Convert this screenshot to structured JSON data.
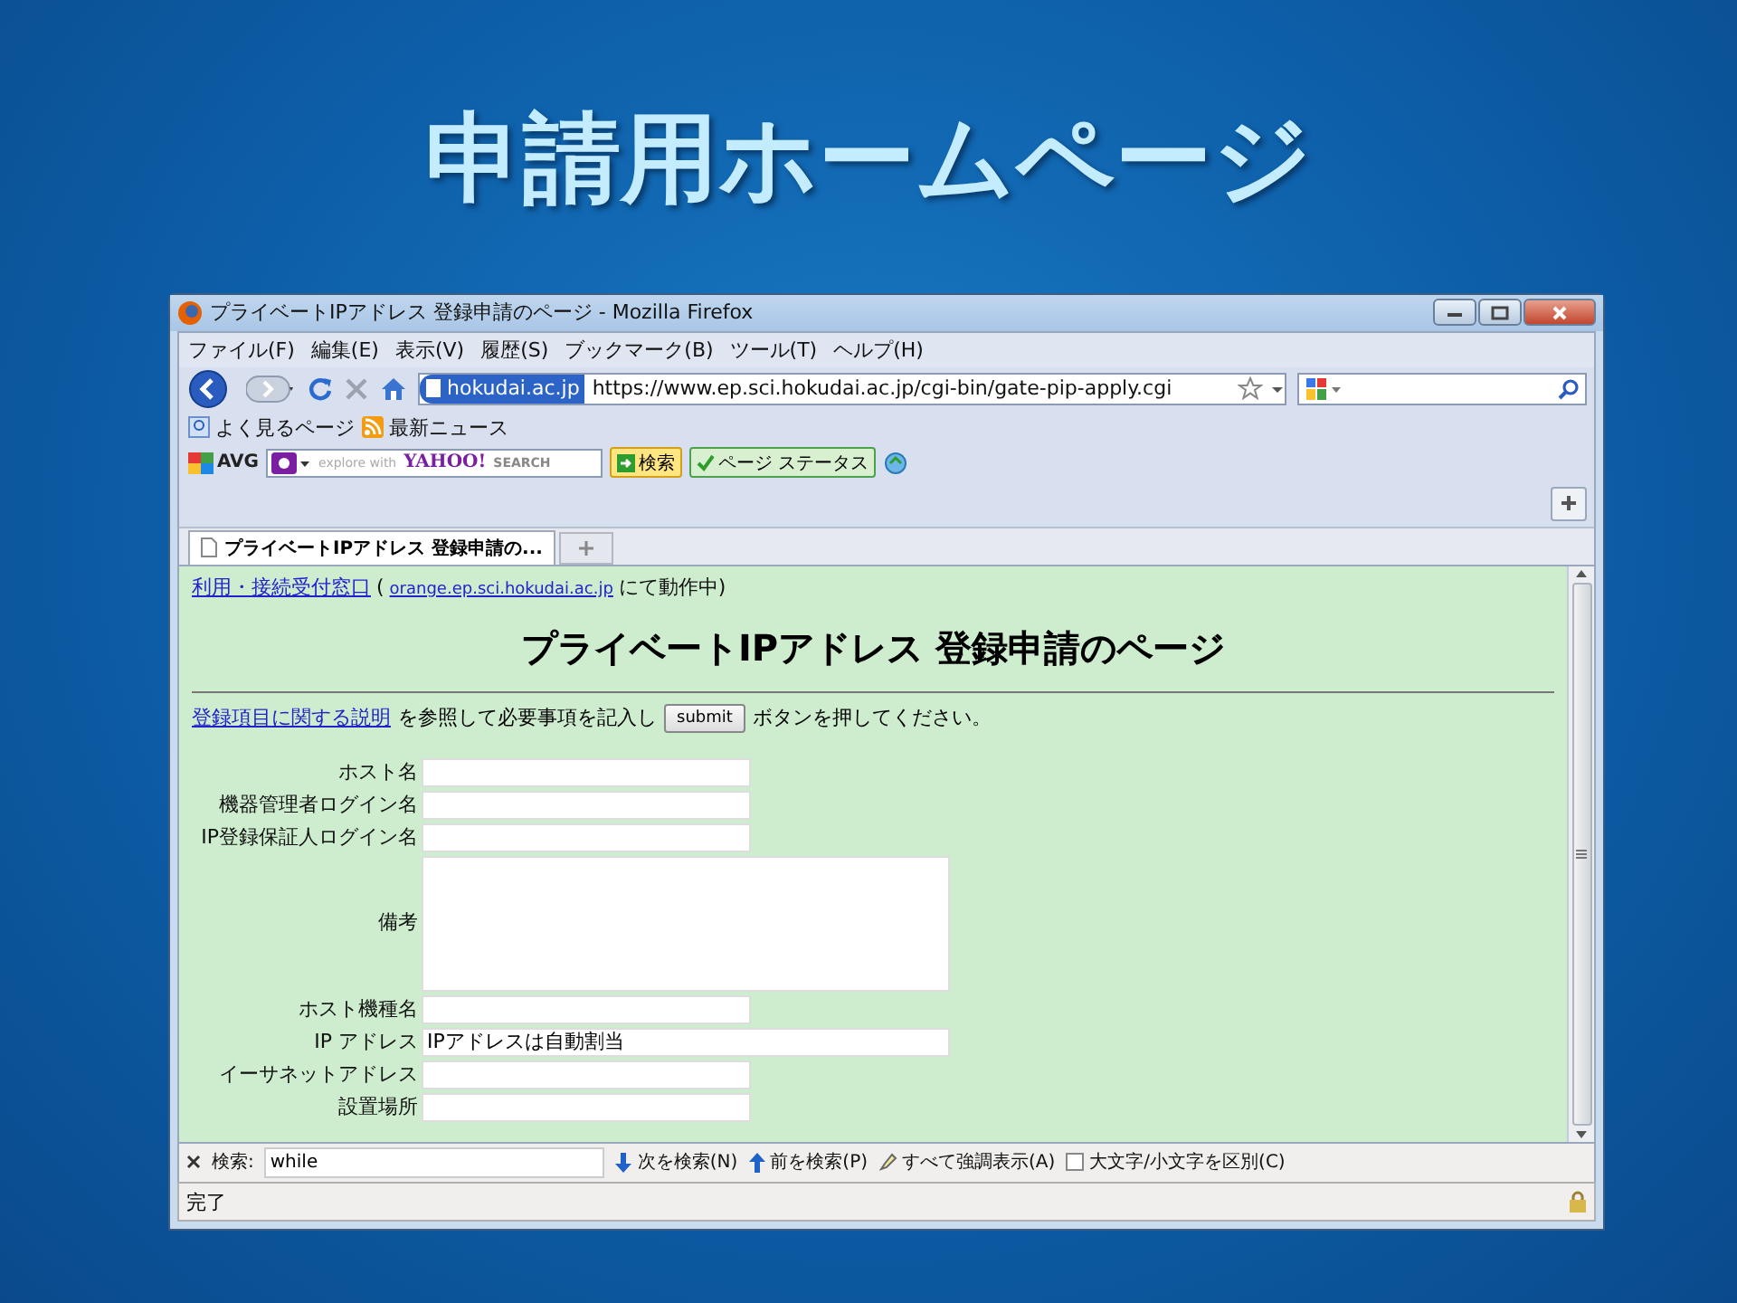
{
  "slide": {
    "title": "申請用ホームページ"
  },
  "window": {
    "title": "プライベートIPアドレス 登録申請のページ - Mozilla Firefox"
  },
  "menu": [
    "ファイル(F)",
    "編集(E)",
    "表示(V)",
    "履歴(S)",
    "ブックマーク(B)",
    "ツール(T)",
    "ヘルプ(H)"
  ],
  "address_bar": {
    "site": "hokudai.ac.jp",
    "url": "https://www.ep.sci.hokudai.ac.jp/cgi-bin/gate-pip-apply.cgi"
  },
  "bookmarks": [
    "よく見るページ",
    "最新ニュース"
  ],
  "toolbar": {
    "brand": "AVG",
    "search_hint": "explore with",
    "search_logo": "YAHOO!",
    "search_label": "SEARCH",
    "search_button": "検索",
    "status_button": "ページ ステータス"
  },
  "tabs": [
    {
      "label": "プライベートIPアドレス 登録申請の...",
      "selected": true
    }
  ],
  "page": {
    "link": "利用・接続受付窓口",
    "paren_open": "(",
    "host_link": "orange.ep.sci.hokudai.ac.jp",
    "running": "にて動作中)",
    "heading": "プライベートIPアドレス 登録申請のページ",
    "help_link": "登録項目に関する説明",
    "instruction_before": "を参照して必要事項を記入し",
    "submit": "submit",
    "instruction_after": "ボタンを押してください。",
    "fields": [
      {
        "label": "ホスト名",
        "kind": "text"
      },
      {
        "label": "機器管理者ログイン名",
        "kind": "text"
      },
      {
        "label": "IP登録保証人ログイン名",
        "kind": "text"
      },
      {
        "label": "備考",
        "kind": "textarea"
      },
      {
        "label": "ホスト機種名",
        "kind": "text"
      },
      {
        "label": "IP アドレス",
        "kind": "wide",
        "value": "IPアドレスは自動割当"
      },
      {
        "label": "イーサネットアドレス",
        "kind": "text"
      },
      {
        "label": "設置場所",
        "kind": "text"
      }
    ]
  },
  "find_bar": {
    "label": "検索:",
    "value": "while",
    "next": "次を検索(N)",
    "prev": "前を検索(P)",
    "highlight": "すべて強調表示(A)",
    "match_case": {
      "label": "大文字/小文字を区別(C)",
      "checked": false
    }
  },
  "status_bar": {
    "text": "完了"
  }
}
